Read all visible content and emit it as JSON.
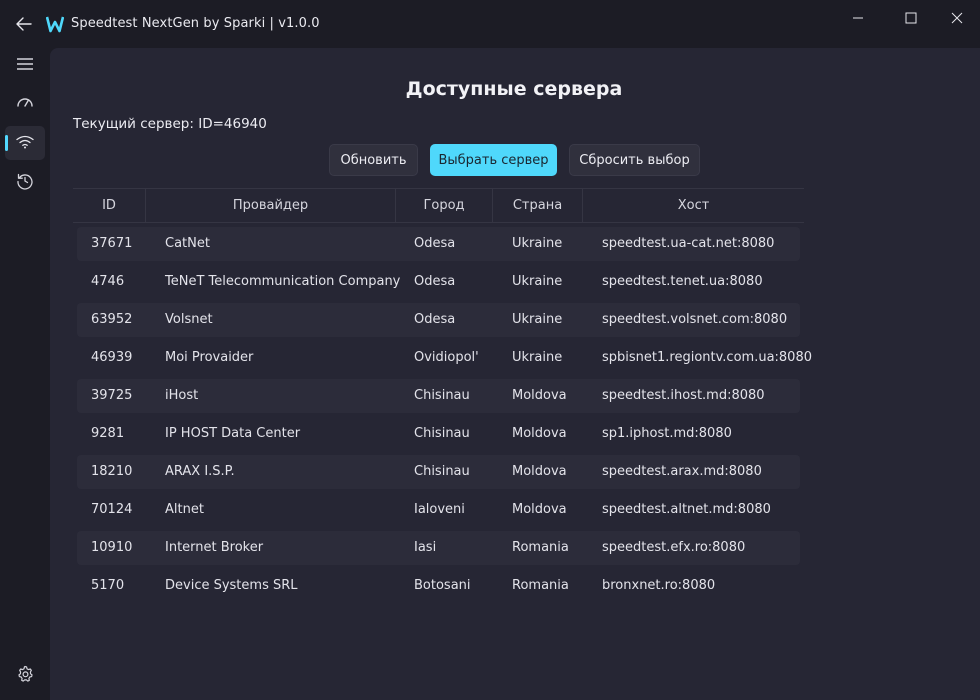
{
  "window": {
    "title": "Speedtest NextGen by Sparki | v1.0.0",
    "accent": "#4fd8fb",
    "icons": [
      "back-arrow-icon",
      "app-logo-icon",
      "minimize-icon",
      "maximize-icon",
      "close-icon"
    ]
  },
  "sidebar": {
    "items": [
      {
        "name": "menu",
        "icon": "hamburger-icon"
      },
      {
        "name": "speedtest",
        "icon": "speedometer-icon"
      },
      {
        "name": "servers",
        "icon": "wifi-icon",
        "active": true
      },
      {
        "name": "history",
        "icon": "history-icon"
      }
    ],
    "settings_icon": "gear-icon"
  },
  "main": {
    "title": "Доступные сервера",
    "current_server": "Текущий сервер: ID=46940",
    "buttons": {
      "refresh": "Обновить",
      "select": "Выбрать сервер",
      "reset": "Сбросить выбор"
    },
    "table": {
      "columns": [
        "ID",
        "Провайдер",
        "Город",
        "Страна",
        "Хост"
      ],
      "rows": [
        [
          "37671",
          "CatNet",
          "Odesa",
          "Ukraine",
          "speedtest.ua-cat.net:8080"
        ],
        [
          "4746",
          "TeNeT Telecommunication Company",
          "Odesa",
          "Ukraine",
          "speedtest.tenet.ua:8080"
        ],
        [
          "63952",
          "Volsnet",
          "Odesa",
          "Ukraine",
          "speedtest.volsnet.com:8080"
        ],
        [
          "46939",
          "Moi Provaider",
          "Ovidiopol'",
          "Ukraine",
          "spbisnet1.regiontv.com.ua:8080"
        ],
        [
          "39725",
          "iHost",
          "Chisinau",
          "Moldova",
          "speedtest.ihost.md:8080"
        ],
        [
          "9281",
          "IP HOST Data Center",
          "Chisinau",
          "Moldova",
          "sp1.iphost.md:8080"
        ],
        [
          "18210",
          "ARAX I.S.P.",
          "Chisinau",
          "Moldova",
          "speedtest.arax.md:8080"
        ],
        [
          "70124",
          "Altnet",
          "Ialoveni",
          "Moldova",
          "speedtest.altnet.md:8080"
        ],
        [
          "10910",
          "Internet Broker",
          "Iasi",
          "Romania",
          "speedtest.efx.ro:8080"
        ],
        [
          "5170",
          "Device Systems SRL",
          "Botosani",
          "Romania",
          "bronxnet.ro:8080"
        ]
      ]
    }
  }
}
